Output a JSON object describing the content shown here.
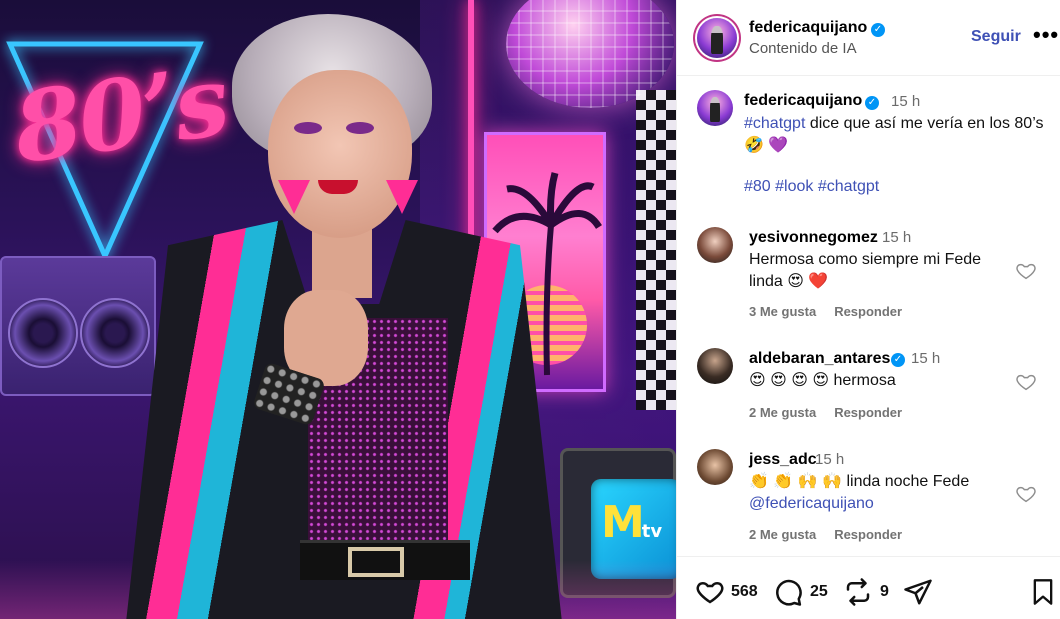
{
  "post": {
    "author": "federicaquijano",
    "subtitle": "Contenido de IA",
    "follow_label": "Seguir",
    "more_label": "•••",
    "caption": {
      "time": "15 h",
      "hashtag": "#chatgpt",
      "text_after": " dice que así me vería en los 80’s ",
      "emojis": "🤣 💜",
      "tags": "#80 #look #chatgpt"
    }
  },
  "comments": [
    {
      "user": "yesivonnegomez",
      "verified": false,
      "time": "15 h",
      "text": "Hermosa como siempre mi Fede linda 😍 ❤️",
      "likes_label": "3 Me gusta",
      "reply_label": "Responder"
    },
    {
      "user": "aldebaran_antares",
      "verified": true,
      "time": "15 h",
      "text": "😍 😍 😍 😍 hermosa",
      "likes_label": "2 Me gusta",
      "reply_label": "Responder"
    },
    {
      "user": "jess_adc",
      "verified": false,
      "time": "15 h",
      "text": "👏 👏 🙌 🙌 linda noche Fede",
      "mention": "@federicaquijano",
      "likes_label": "2 Me gusta",
      "reply_label": "Responder"
    }
  ],
  "actions": {
    "likes": "568",
    "comments": "25",
    "reposts": "9"
  },
  "photo": {
    "neon_text": "80’s",
    "tv_logo": "M",
    "tv_logo_small": "tv"
  },
  "colors": {
    "link": "#3f51b5",
    "verified": "#0095f6",
    "meta": "#737373"
  }
}
